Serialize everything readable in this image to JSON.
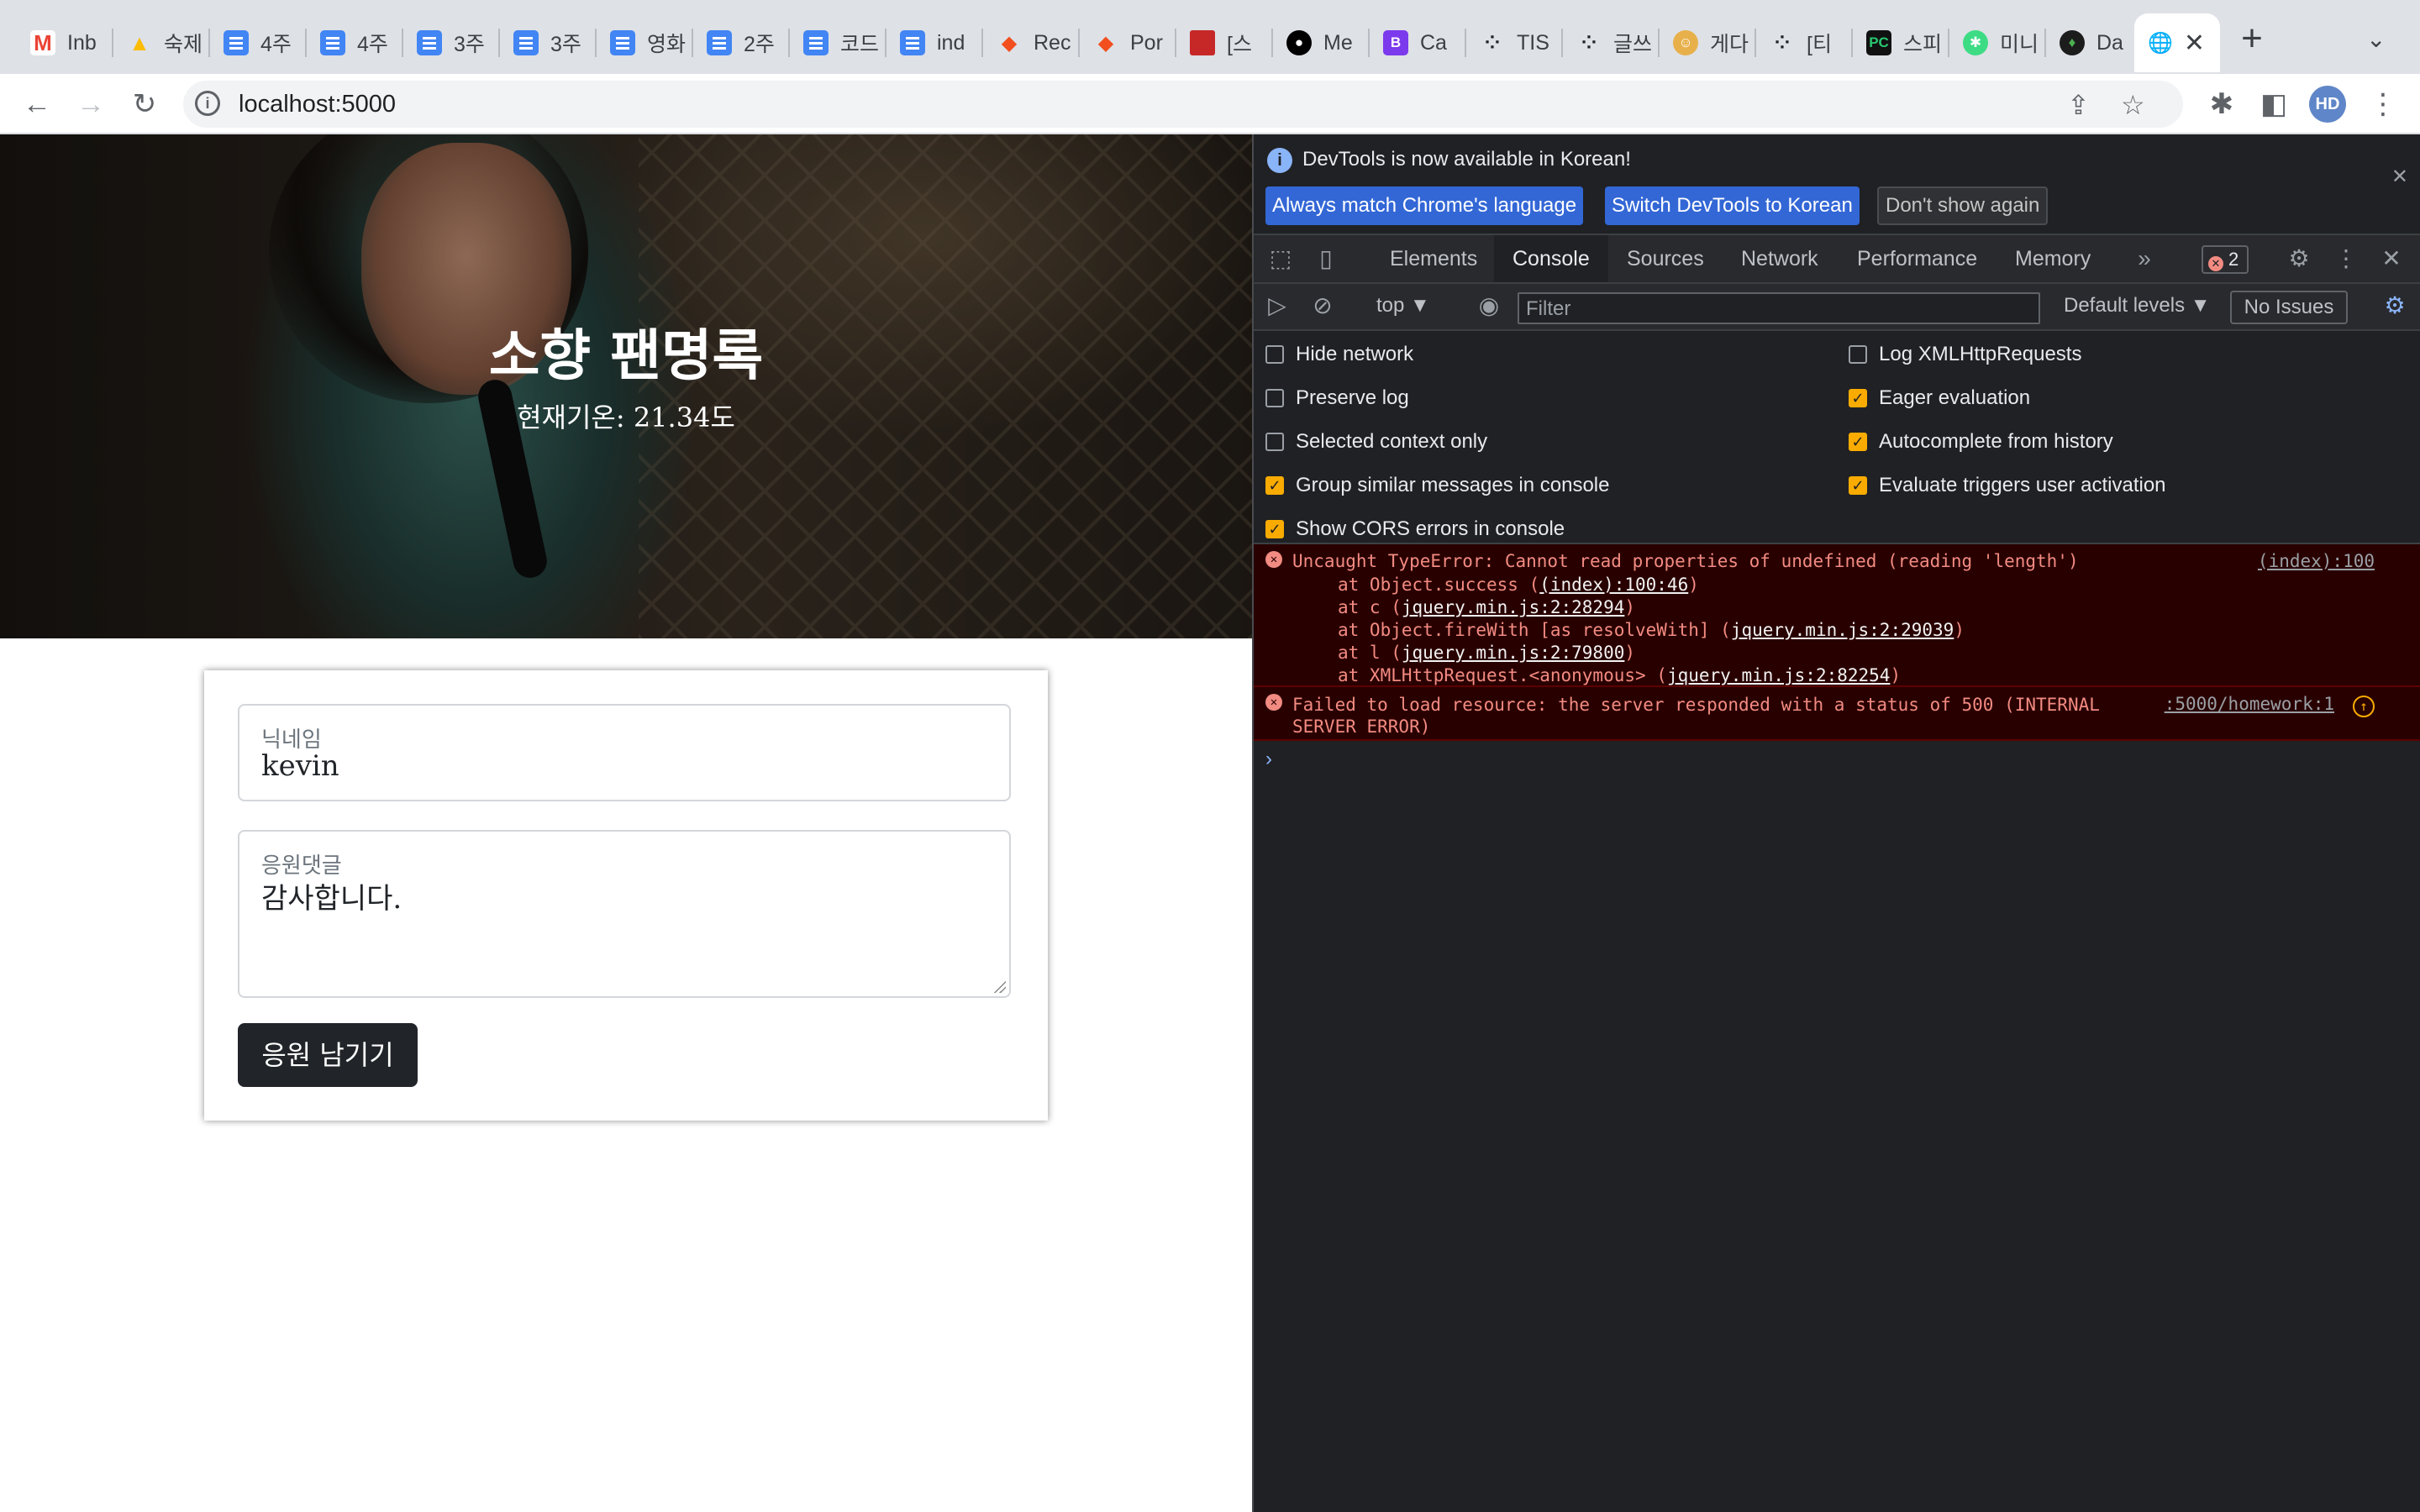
{
  "browser": {
    "tabs": [
      {
        "title": "Inb",
        "icon": "gmail-icon"
      },
      {
        "title": "숙제",
        "icon": "google-drive-icon"
      },
      {
        "title": "4주",
        "icon": "google-docs-icon"
      },
      {
        "title": "4주",
        "icon": "google-docs-icon"
      },
      {
        "title": "3주",
        "icon": "google-docs-icon"
      },
      {
        "title": "3주",
        "icon": "google-docs-icon"
      },
      {
        "title": "영화",
        "icon": "google-docs-icon"
      },
      {
        "title": "2주",
        "icon": "google-docs-icon"
      },
      {
        "title": "코드",
        "icon": "google-docs-icon"
      },
      {
        "title": "ind",
        "icon": "google-docs-icon"
      },
      {
        "title": "Rec",
        "icon": "figma-icon"
      },
      {
        "title": "Por",
        "icon": "figma-icon"
      },
      {
        "title": "[스",
        "icon": "book-icon"
      },
      {
        "title": "Me",
        "icon": "medium-icon"
      },
      {
        "title": "Ca",
        "icon": "bootstrap-icon"
      },
      {
        "title": "TIS",
        "icon": "dots-icon"
      },
      {
        "title": "글쓰",
        "icon": "dots-icon"
      },
      {
        "title": "게다",
        "icon": "cowboy-icon"
      },
      {
        "title": "[티",
        "icon": "dots-icon"
      },
      {
        "title": "스피",
        "icon": "pycharm-icon"
      },
      {
        "title": "미니",
        "icon": "green-app-icon"
      },
      {
        "title": "Da",
        "icon": "mongodb-icon"
      },
      {
        "title": "",
        "icon": "globe-icon",
        "active": true
      }
    ],
    "url": "localhost:5000",
    "profile_initials": "HD"
  },
  "page": {
    "title": "소향 팬명록",
    "temperature": "현재기온: 21.34도",
    "form": {
      "nickname_label": "닉네임",
      "nickname_value": "kevin",
      "comment_label": "응원댓글",
      "comment_value": "감사합니다.",
      "submit_label": "응원 남기기"
    }
  },
  "devtools": {
    "infobar": {
      "message": "DevTools is now available in Korean!",
      "btn_match": "Always match Chrome's language",
      "btn_switch": "Switch DevTools to Korean",
      "btn_dismiss": "Don't show again"
    },
    "tabs": [
      "Elements",
      "Console",
      "Sources",
      "Network",
      "Performance",
      "Memory"
    ],
    "active_tab": "Console",
    "error_count": "2",
    "context": "top ▼",
    "filter_placeholder": "Filter",
    "levels": "Default levels ▼",
    "issues": "No Issues",
    "settings": {
      "left": [
        {
          "label": "Hide network",
          "checked": false
        },
        {
          "label": "Preserve log",
          "checked": false
        },
        {
          "label": "Selected context only",
          "checked": false
        },
        {
          "label": "Group similar messages in console",
          "checked": true
        },
        {
          "label": "Show CORS errors in console",
          "checked": true
        }
      ],
      "right": [
        {
          "label": "Log XMLHttpRequests",
          "checked": false
        },
        {
          "label": "Eager evaluation",
          "checked": true
        },
        {
          "label": "Autocomplete from history",
          "checked": true
        },
        {
          "label": "Evaluate triggers user activation",
          "checked": true
        }
      ]
    },
    "errors": [
      {
        "message": "Uncaught TypeError: Cannot read properties of undefined (reading 'length')",
        "source": "(index):100",
        "stack": [
          {
            "prefix": "at Object.success (",
            "link": "(index):100:46",
            "suffix": ")"
          },
          {
            "prefix": "at c (",
            "link": "jquery.min.js:2:28294",
            "suffix": ")"
          },
          {
            "prefix": "at Object.fireWith [as resolveWith] (",
            "link": "jquery.min.js:2:29039",
            "suffix": ")"
          },
          {
            "prefix": "at l (",
            "link": "jquery.min.js:2:79800",
            "suffix": ")"
          },
          {
            "prefix": "at XMLHttpRequest.<anonymous> (",
            "link": "jquery.min.js:2:82254",
            "suffix": ")"
          }
        ]
      },
      {
        "message": "Failed to load resource: the server responded with a status of 500 (INTERNAL SERVER ERROR)",
        "source": ":5000/homework:1"
      }
    ],
    "prompt": "›"
  }
}
